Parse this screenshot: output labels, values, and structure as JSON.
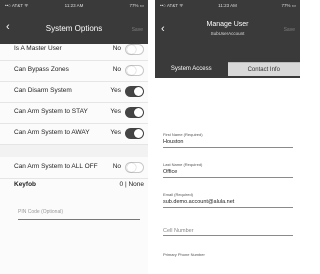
{
  "left_screen": {
    "status_bar": {
      "carrier": "••○ AT&T ᯤ",
      "time": "11:23 AM",
      "battery": "77% ▭"
    },
    "header": {
      "title": "System Options",
      "action": "Save"
    },
    "rows": [
      {
        "label": "Is A Master User",
        "value": "No",
        "state": "off"
      },
      {
        "label": "Can Bypass Zones",
        "value": "No",
        "state": "off"
      },
      {
        "label": "Can Disarm System",
        "value": "Yes",
        "state": "on"
      },
      {
        "label": "Can Arm System to STAY",
        "value": "Yes",
        "state": "on"
      },
      {
        "label": "Can Arm System to AWAY",
        "value": "Yes",
        "state": "on"
      }
    ],
    "all_off_row": {
      "label": "Can Arm System to ALL OFF",
      "value": "No",
      "state": "off"
    },
    "keyfob": {
      "label": "Keyfob",
      "value": "0 | None"
    },
    "pin_field": {
      "placeholder": "PIN Code (Optional)"
    }
  },
  "right_screen": {
    "status_bar": {
      "carrier": "••○ AT&T ᯤ",
      "time": "11:23 AM",
      "battery": "77% ▭"
    },
    "header": {
      "title": "Manage User",
      "subtitle": "SubUserAccount",
      "action": "Save"
    },
    "tabs": [
      {
        "label": "System Access",
        "active": true
      },
      {
        "label": "Contact Info",
        "active": false
      }
    ],
    "fields": {
      "first_name": {
        "label": "First Name (Required)",
        "value": "Houston"
      },
      "last_name": {
        "label": "Last Name (Required)",
        "value": "Office"
      },
      "email": {
        "label": "Email (Required)",
        "value": "sub.demo.account@alula.net"
      },
      "cell": {
        "placeholder": "Cell Number"
      },
      "primary_phone": {
        "label": "Primary Phone Number"
      }
    }
  }
}
